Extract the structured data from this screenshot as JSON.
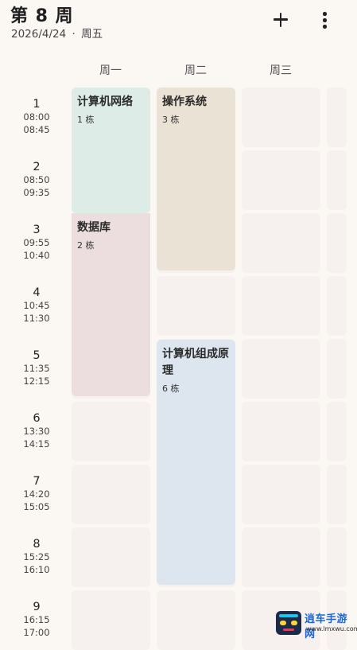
{
  "header": {
    "week_title": "第 8 周",
    "date": "2026/4/24",
    "separator": "·",
    "weekday": "周五",
    "add_icon": "plus-icon",
    "more_icon": "more-vertical-icon"
  },
  "days": [
    "周一",
    "周二",
    "周三"
  ],
  "periods": [
    {
      "num": "1",
      "start": "08:00",
      "end": "08:45"
    },
    {
      "num": "2",
      "start": "08:50",
      "end": "09:35"
    },
    {
      "num": "3",
      "start": "09:55",
      "end": "10:40"
    },
    {
      "num": "4",
      "start": "10:45",
      "end": "11:30"
    },
    {
      "num": "5",
      "start": "11:35",
      "end": "12:15"
    },
    {
      "num": "6",
      "start": "13:30",
      "end": "14:15"
    },
    {
      "num": "7",
      "start": "14:20",
      "end": "15:05"
    },
    {
      "num": "8",
      "start": "15:25",
      "end": "16:10"
    },
    {
      "num": "9",
      "start": "16:15",
      "end": "17:00"
    }
  ],
  "courses": [
    {
      "name": "计算机网络",
      "room": "1 栋",
      "color": "#ddece6"
    },
    {
      "name": "数据库",
      "room": "2 栋",
      "color": "#ecdede"
    },
    {
      "name": "操作系统",
      "room": "3 栋",
      "color": "#ebe2d6"
    },
    {
      "name": "计算机组成原理",
      "room": "6 栋",
      "color": "#dde6ee"
    }
  ],
  "colors": {
    "background": "#fbf7f3",
    "empty_cell": "#f6f0ee",
    "text": "#1f1f1f"
  },
  "watermark": {
    "text": "逍车手游网",
    "url": "www.lmxwu.com"
  }
}
